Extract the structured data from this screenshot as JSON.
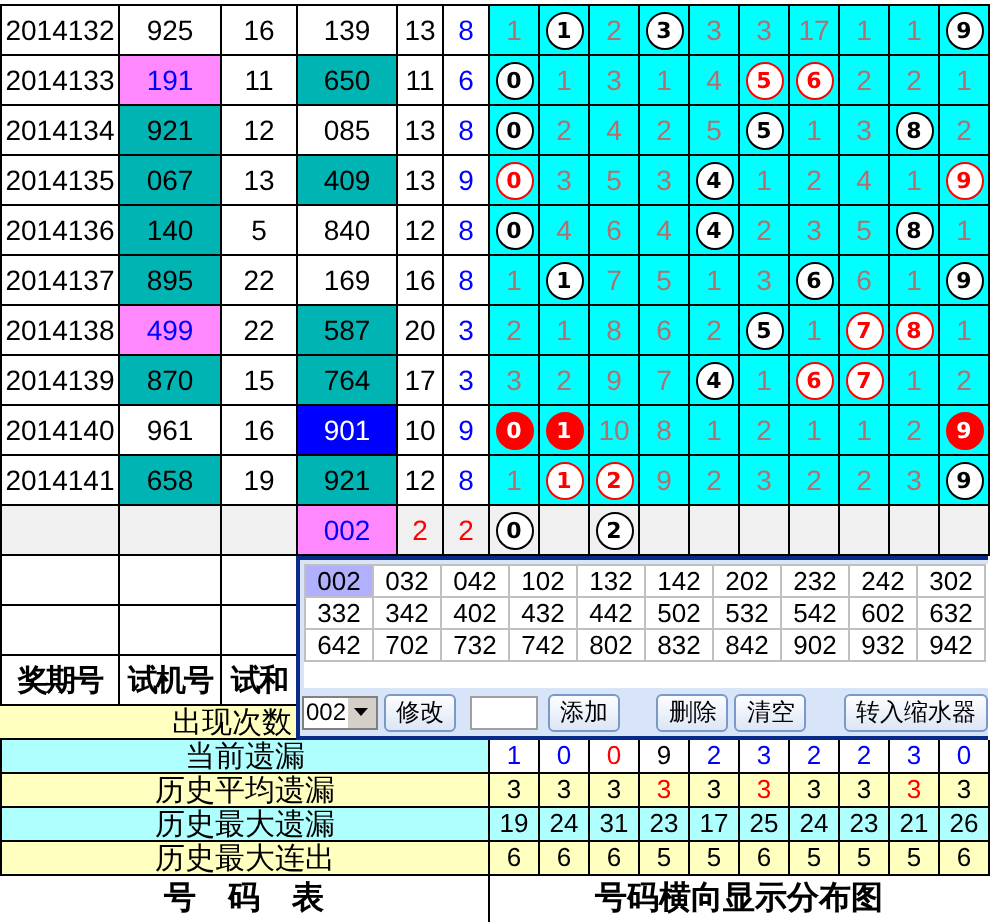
{
  "rows": [
    {
      "pending": false,
      "period": "2014132",
      "trial": {
        "text": "925",
        "color": "#ffffff"
      },
      "trial_sum": "16",
      "draw": {
        "text": "139",
        "color": "#ffffff"
      },
      "column_5": {
        "text": "13",
        "color": "#000000"
      },
      "column_6": {
        "text": "8",
        "color": "#0000ff"
      },
      "digits": [
        {
          "kind": "plain",
          "text": "1"
        },
        {
          "kind": "ball",
          "text": "1"
        },
        {
          "kind": "plain",
          "text": "2"
        },
        {
          "kind": "ball",
          "text": "3"
        },
        {
          "kind": "plain",
          "text": "3"
        },
        {
          "kind": "plain",
          "text": "3"
        },
        {
          "kind": "plain",
          "text": "17"
        },
        {
          "kind": "plain",
          "text": "1"
        },
        {
          "kind": "plain",
          "text": "1"
        },
        {
          "kind": "ball",
          "text": "9"
        }
      ]
    },
    {
      "pending": false,
      "period": "2014133",
      "trial": {
        "text": "191",
        "color": "#ff88ff"
      },
      "trial_sum": "11",
      "draw": {
        "text": "650",
        "color": "#00b4b4"
      },
      "column_5": {
        "text": "11",
        "color": "#000000"
      },
      "column_6": {
        "text": "6",
        "color": "#0000ff"
      },
      "digits": [
        {
          "kind": "ball",
          "text": "0"
        },
        {
          "kind": "plain",
          "text": "1"
        },
        {
          "kind": "plain",
          "text": "3"
        },
        {
          "kind": "plain",
          "text": "1"
        },
        {
          "kind": "plain",
          "text": "4"
        },
        {
          "kind": "ring",
          "text": "5"
        },
        {
          "kind": "ring",
          "text": "6"
        },
        {
          "kind": "plain",
          "text": "2"
        },
        {
          "kind": "plain",
          "text": "2"
        },
        {
          "kind": "plain",
          "text": "1"
        }
      ]
    },
    {
      "pending": false,
      "period": "2014134",
      "trial": {
        "text": "921",
        "color": "#00b4b4"
      },
      "trial_sum": "12",
      "draw": {
        "text": "085",
        "color": "#ffffff"
      },
      "column_5": {
        "text": "13",
        "color": "#000000"
      },
      "column_6": {
        "text": "8",
        "color": "#0000ff"
      },
      "digits": [
        {
          "kind": "ball",
          "text": "0"
        },
        {
          "kind": "plain",
          "text": "2"
        },
        {
          "kind": "plain",
          "text": "4"
        },
        {
          "kind": "plain",
          "text": "2"
        },
        {
          "kind": "plain",
          "text": "5"
        },
        {
          "kind": "ball",
          "text": "5"
        },
        {
          "kind": "plain",
          "text": "1"
        },
        {
          "kind": "plain",
          "text": "3"
        },
        {
          "kind": "ball",
          "text": "8"
        },
        {
          "kind": "plain",
          "text": "2"
        }
      ]
    },
    {
      "pending": false,
      "period": "2014135",
      "trial": {
        "text": "067",
        "color": "#00b4b4"
      },
      "trial_sum": "13",
      "draw": {
        "text": "409",
        "color": "#00b4b4"
      },
      "column_5": {
        "text": "13",
        "color": "#000000"
      },
      "column_6": {
        "text": "9",
        "color": "#0000ff"
      },
      "digits": [
        {
          "kind": "ring",
          "text": "0"
        },
        {
          "kind": "plain",
          "text": "3"
        },
        {
          "kind": "plain",
          "text": "5"
        },
        {
          "kind": "plain",
          "text": "3"
        },
        {
          "kind": "ball",
          "text": "4"
        },
        {
          "kind": "plain",
          "text": "1"
        },
        {
          "kind": "plain",
          "text": "2"
        },
        {
          "kind": "plain",
          "text": "4"
        },
        {
          "kind": "plain",
          "text": "1"
        },
        {
          "kind": "ring",
          "text": "9"
        }
      ]
    },
    {
      "pending": false,
      "period": "2014136",
      "trial": {
        "text": "140",
        "color": "#00b4b4"
      },
      "trial_sum": "5",
      "draw": {
        "text": "840",
        "color": "#ffffff"
      },
      "column_5": {
        "text": "12",
        "color": "#000000"
      },
      "column_6": {
        "text": "8",
        "color": "#0000ff"
      },
      "digits": [
        {
          "kind": "ball",
          "text": "0"
        },
        {
          "kind": "plain",
          "text": "4"
        },
        {
          "kind": "plain",
          "text": "6"
        },
        {
          "kind": "plain",
          "text": "4"
        },
        {
          "kind": "ball",
          "text": "4"
        },
        {
          "kind": "plain",
          "text": "2"
        },
        {
          "kind": "plain",
          "text": "3"
        },
        {
          "kind": "plain",
          "text": "5"
        },
        {
          "kind": "ball",
          "text": "8"
        },
        {
          "kind": "plain",
          "text": "1"
        }
      ]
    },
    {
      "pending": false,
      "period": "2014137",
      "trial": {
        "text": "895",
        "color": "#00b4b4"
      },
      "trial_sum": "22",
      "draw": {
        "text": "169",
        "color": "#ffffff"
      },
      "column_5": {
        "text": "16",
        "color": "#000000"
      },
      "column_6": {
        "text": "8",
        "color": "#0000ff"
      },
      "digits": [
        {
          "kind": "plain",
          "text": "1"
        },
        {
          "kind": "ball",
          "text": "1"
        },
        {
          "kind": "plain",
          "text": "7"
        },
        {
          "kind": "plain",
          "text": "5"
        },
        {
          "kind": "plain",
          "text": "1"
        },
        {
          "kind": "plain",
          "text": "3"
        },
        {
          "kind": "ball",
          "text": "6"
        },
        {
          "kind": "plain",
          "text": "6"
        },
        {
          "kind": "plain",
          "text": "1"
        },
        {
          "kind": "ball",
          "text": "9"
        }
      ]
    },
    {
      "pending": false,
      "period": "2014138",
      "trial": {
        "text": "499",
        "color": "#ff88ff"
      },
      "trial_sum": "22",
      "draw": {
        "text": "587",
        "color": "#00b4b4"
      },
      "column_5": {
        "text": "20",
        "color": "#000000"
      },
      "column_6": {
        "text": "3",
        "color": "#0000ff"
      },
      "digits": [
        {
          "kind": "plain",
          "text": "2"
        },
        {
          "kind": "plain",
          "text": "1"
        },
        {
          "kind": "plain",
          "text": "8"
        },
        {
          "kind": "plain",
          "text": "6"
        },
        {
          "kind": "plain",
          "text": "2"
        },
        {
          "kind": "ball",
          "text": "5"
        },
        {
          "kind": "plain",
          "text": "1"
        },
        {
          "kind": "ring",
          "text": "7"
        },
        {
          "kind": "ring",
          "text": "8"
        },
        {
          "kind": "plain",
          "text": "1"
        }
      ]
    },
    {
      "pending": false,
      "period": "2014139",
      "trial": {
        "text": "870",
        "color": "#00b4b4"
      },
      "trial_sum": "15",
      "draw": {
        "text": "764",
        "color": "#00b4b4"
      },
      "column_5": {
        "text": "17",
        "color": "#000000"
      },
      "column_6": {
        "text": "3",
        "color": "#0000ff"
      },
      "digits": [
        {
          "kind": "plain",
          "text": "3"
        },
        {
          "kind": "plain",
          "text": "2"
        },
        {
          "kind": "plain",
          "text": "9"
        },
        {
          "kind": "plain",
          "text": "7"
        },
        {
          "kind": "ball",
          "text": "4"
        },
        {
          "kind": "plain",
          "text": "1"
        },
        {
          "kind": "ring",
          "text": "6"
        },
        {
          "kind": "ring",
          "text": "7"
        },
        {
          "kind": "plain",
          "text": "1"
        },
        {
          "kind": "plain",
          "text": "2"
        }
      ]
    },
    {
      "pending": false,
      "period": "2014140",
      "trial": {
        "text": "961",
        "color": "#ffffff"
      },
      "trial_sum": "16",
      "draw": {
        "text": "901",
        "color": "#0000ff"
      },
      "column_5": {
        "text": "10",
        "color": "#000000"
      },
      "column_6": {
        "text": "9",
        "color": "#0000ff"
      },
      "digits": [
        {
          "kind": "filled",
          "text": "0"
        },
        {
          "kind": "filled",
          "text": "1"
        },
        {
          "kind": "plain",
          "text": "10"
        },
        {
          "kind": "plain",
          "text": "8"
        },
        {
          "kind": "plain",
          "text": "1"
        },
        {
          "kind": "plain",
          "text": "2"
        },
        {
          "kind": "plain",
          "text": "1"
        },
        {
          "kind": "plain",
          "text": "1"
        },
        {
          "kind": "plain",
          "text": "2"
        },
        {
          "kind": "filled",
          "text": "9"
        }
      ]
    },
    {
      "pending": false,
      "period": "2014141",
      "trial": {
        "text": "658",
        "color": "#00b4b4"
      },
      "trial_sum": "19",
      "draw": {
        "text": "921",
        "color": "#00b4b4"
      },
      "column_5": {
        "text": "12",
        "color": "#000000"
      },
      "column_6": {
        "text": "8",
        "color": "#0000ff"
      },
      "digits": [
        {
          "kind": "plain",
          "text": "1"
        },
        {
          "kind": "ring",
          "text": "1"
        },
        {
          "kind": "ring",
          "text": "2"
        },
        {
          "kind": "plain",
          "text": "9"
        },
        {
          "kind": "plain",
          "text": "2"
        },
        {
          "kind": "plain",
          "text": "3"
        },
        {
          "kind": "plain",
          "text": "2"
        },
        {
          "kind": "plain",
          "text": "2"
        },
        {
          "kind": "plain",
          "text": "3"
        },
        {
          "kind": "ball",
          "text": "9"
        }
      ]
    },
    {
      "pending": true,
      "draw": {
        "text": "002",
        "color": "#ff88ff"
      },
      "column_5": {
        "text": "2",
        "color": "#ff0000"
      },
      "column_6": {
        "text": "2",
        "color": "#ff0000"
      },
      "digits": [
        {
          "kind": "ball",
          "text": "0"
        },
        {
          "kind": "empty"
        },
        {
          "kind": "ball",
          "text": "2"
        },
        {
          "kind": "empty"
        },
        {
          "kind": "empty"
        },
        {
          "kind": "empty"
        },
        {
          "kind": "empty"
        },
        {
          "kind": "empty"
        },
        {
          "kind": "empty"
        },
        {
          "kind": "empty"
        }
      ]
    }
  ],
  "header_labels": [
    "奖期号",
    "试机号",
    "试和"
  ],
  "appearance_label": "出现次数",
  "popup": {
    "candidates": [
      {
        "text": "002",
        "selected": true
      },
      {
        "text": "032",
        "selected": false
      },
      {
        "text": "042",
        "selected": false
      },
      {
        "text": "102",
        "selected": false
      },
      {
        "text": "132",
        "selected": false
      },
      {
        "text": "142",
        "selected": false
      },
      {
        "text": "202",
        "selected": false
      },
      {
        "text": "232",
        "selected": false
      },
      {
        "text": "242",
        "selected": false
      },
      {
        "text": "302",
        "selected": false
      },
      {
        "text": "332",
        "selected": false
      },
      {
        "text": "342",
        "selected": false
      },
      {
        "text": "402",
        "selected": false
      },
      {
        "text": "432",
        "selected": false
      },
      {
        "text": "442",
        "selected": false
      },
      {
        "text": "502",
        "selected": false
      },
      {
        "text": "532",
        "selected": false
      },
      {
        "text": "542",
        "selected": false
      },
      {
        "text": "602",
        "selected": false
      },
      {
        "text": "632",
        "selected": false
      },
      {
        "text": "642",
        "selected": false
      },
      {
        "text": "702",
        "selected": false
      },
      {
        "text": "732",
        "selected": false
      },
      {
        "text": "742",
        "selected": false
      },
      {
        "text": "802",
        "selected": false
      },
      {
        "text": "832",
        "selected": false
      },
      {
        "text": "842",
        "selected": false
      },
      {
        "text": "902",
        "selected": false
      },
      {
        "text": "932",
        "selected": false
      },
      {
        "text": "942",
        "selected": false
      }
    ],
    "dropdown_value": "002",
    "edit_button": "修改",
    "buttons": [
      "添加",
      "删除",
      "清空",
      "转入缩水器"
    ]
  },
  "stats": [
    {
      "kind": "current",
      "label": "当前遗漏",
      "values": [
        {
          "text": "1",
          "color": "#0000ff"
        },
        {
          "text": "0",
          "color": "#0000ff"
        },
        {
          "text": "0",
          "color": "#ff0000"
        },
        {
          "text": "9",
          "color": "#000000"
        },
        {
          "text": "2",
          "color": "#0000ff"
        },
        {
          "text": "3",
          "color": "#0000ff"
        },
        {
          "text": "2",
          "color": "#0000ff"
        },
        {
          "text": "2",
          "color": "#0000ff"
        },
        {
          "text": "3",
          "color": "#0000ff"
        },
        {
          "text": "0",
          "color": "#0000ff"
        }
      ]
    },
    {
      "kind": "yellow",
      "label": "历史平均遗漏",
      "values": [
        {
          "text": "3",
          "color": "#000000"
        },
        {
          "text": "3",
          "color": "#000000"
        },
        {
          "text": "3",
          "color": "#000000"
        },
        {
          "text": "3",
          "color": "#ff0000"
        },
        {
          "text": "3",
          "color": "#000000"
        },
        {
          "text": "3",
          "color": "#ff0000"
        },
        {
          "text": "3",
          "color": "#000000"
        },
        {
          "text": "3",
          "color": "#000000"
        },
        {
          "text": "3",
          "color": "#ff0000"
        },
        {
          "text": "3",
          "color": "#000000"
        }
      ]
    },
    {
      "kind": "cyan",
      "label": "历史最大遗漏",
      "values": [
        {
          "text": "19",
          "color": "#000000"
        },
        {
          "text": "24",
          "color": "#000000"
        },
        {
          "text": "31",
          "color": "#000000"
        },
        {
          "text": "23",
          "color": "#000000"
        },
        {
          "text": "17",
          "color": "#000000"
        },
        {
          "text": "25",
          "color": "#000000"
        },
        {
          "text": "24",
          "color": "#000000"
        },
        {
          "text": "23",
          "color": "#000000"
        },
        {
          "text": "21",
          "color": "#000000"
        },
        {
          "text": "26",
          "color": "#000000"
        }
      ]
    },
    {
      "kind": "yellow",
      "label": "历史最大连出",
      "values": [
        {
          "text": "6",
          "color": "#000000"
        },
        {
          "text": "6",
          "color": "#000000"
        },
        {
          "text": "6",
          "color": "#000000"
        },
        {
          "text": "5",
          "color": "#000000"
        },
        {
          "text": "5",
          "color": "#000000"
        },
        {
          "text": "6",
          "color": "#000000"
        },
        {
          "text": "5",
          "color": "#000000"
        },
        {
          "text": "5",
          "color": "#000000"
        },
        {
          "text": "5",
          "color": "#000000"
        },
        {
          "text": "6",
          "color": "#000000"
        }
      ]
    }
  ],
  "footer": [
    "号　码　表",
    "号码横向显示分布图"
  ]
}
